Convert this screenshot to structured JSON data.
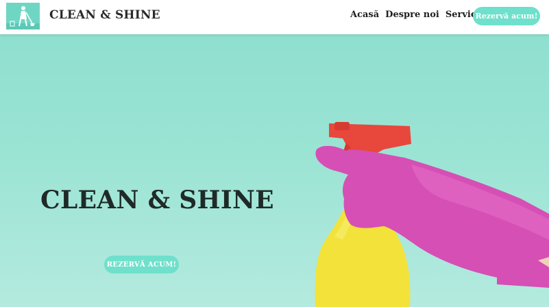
{
  "header": {
    "brand": "CLEAN & SHINE",
    "nav": [
      "Acasă",
      "Despre noi",
      "Servicii"
    ],
    "cta_label": "Rezervă acum!"
  },
  "hero": {
    "title": "CLEAN & SHINE",
    "cta_label": "REZERVĂ ACUM!",
    "image": "spray-bottle-with-glove"
  },
  "colors": {
    "accent": "#6fe0cb",
    "hero_bg": "#9be4d4",
    "glove": "#d64fb5",
    "bottle": "#f2e23a",
    "trigger": "#e8473c"
  }
}
